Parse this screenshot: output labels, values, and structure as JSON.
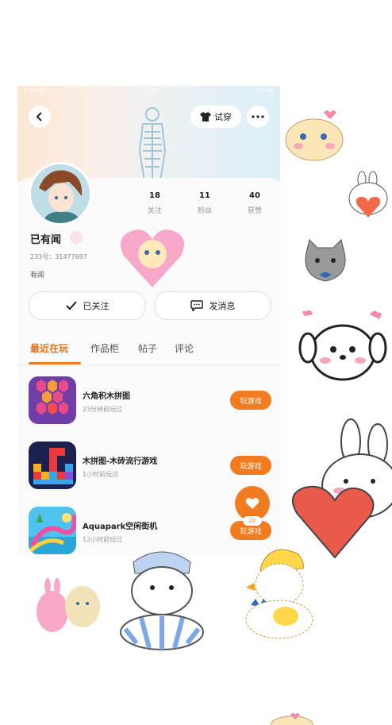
{
  "status_bar": {
    "left": "8:18 HD",
    "center": "11:17",
    "right": "5G 98"
  },
  "header": {
    "tryon_label": "试穿"
  },
  "profile": {
    "name": "已有闻",
    "uid": "233号：31477697",
    "bio": "有闻",
    "stats": [
      {
        "value": "18",
        "label": "关注"
      },
      {
        "value": "11",
        "label": "粉丝"
      },
      {
        "value": "40",
        "label": "获赞"
      }
    ]
  },
  "actions": {
    "follow_label": "已关注",
    "message_label": "发消息"
  },
  "tabs": [
    "最近在玩",
    "作品柜",
    "帖子",
    "评论"
  ],
  "games": [
    {
      "title": "六角积木拼图",
      "time": "23分钟前玩过",
      "button": "玩游戏"
    },
    {
      "title": "木拼图-木砖流行游戏",
      "time": "1小时前玩过",
      "button": "玩游戏"
    },
    {
      "title": "Aquapark空闲街机",
      "time": "12小时前玩过",
      "button": "玩游戏"
    }
  ],
  "fab": {
    "count": "22"
  },
  "colors": {
    "accent": "#f07c1f"
  }
}
